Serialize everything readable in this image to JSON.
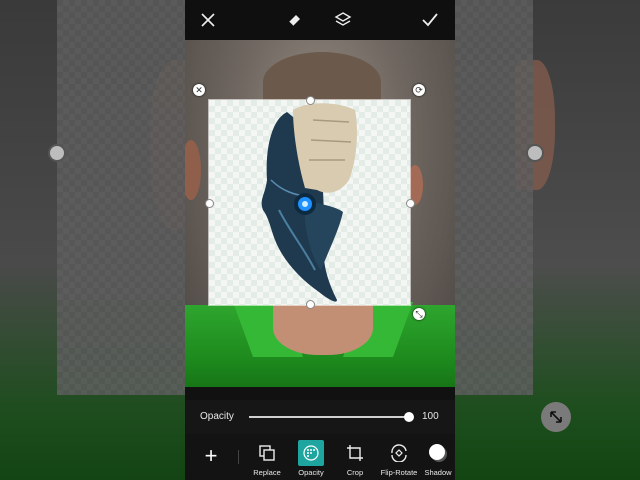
{
  "topbar": {
    "close_icon": "close-icon",
    "eraser_icon": "eraser-icon",
    "layers_icon": "layers-icon",
    "apply_icon": "checkmark-icon"
  },
  "opacity": {
    "label": "Opacity",
    "value": "100",
    "level": 1.0
  },
  "tools": [
    {
      "label": "Replace",
      "icon": "replace-icon"
    },
    {
      "label": "Opacity",
      "icon": "opacity-icon",
      "active": true
    },
    {
      "label": "Crop",
      "icon": "crop-icon"
    },
    {
      "label": "Flip-Rotate",
      "icon": "flip-rotate-icon"
    },
    {
      "label": "Shadow",
      "icon": "shadow-icon"
    }
  ],
  "colors": {
    "accent": "#1ea5a0",
    "shirt": "#2ea62e"
  }
}
